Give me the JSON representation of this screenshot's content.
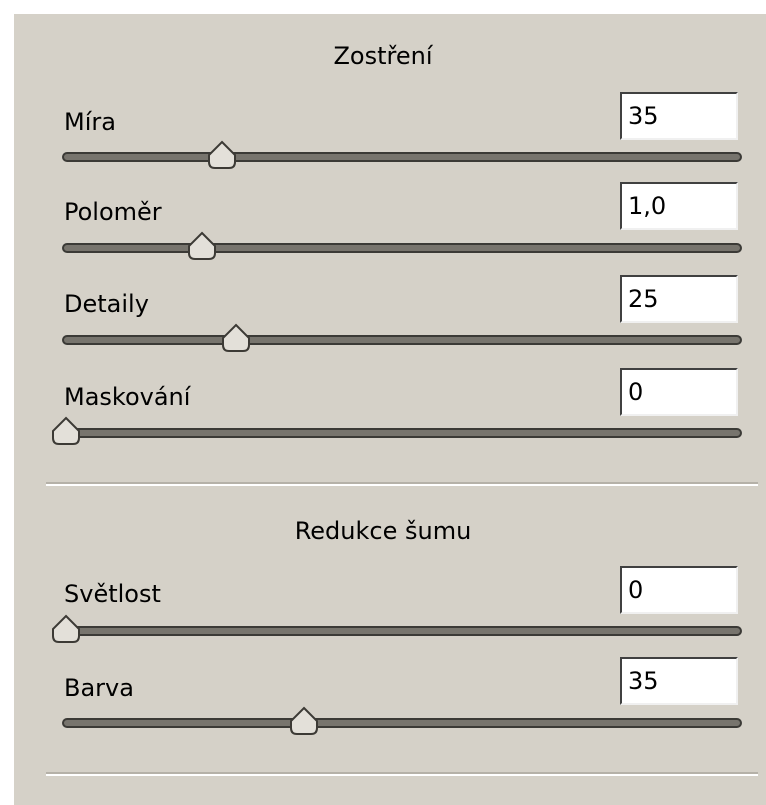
{
  "sharpening": {
    "title": "Zostření",
    "sliders": [
      {
        "label": "Míra",
        "value": "35",
        "level": 0.23
      },
      {
        "label": "Poloměr",
        "value": "1,0",
        "level": 0.2
      },
      {
        "label": "Detaily",
        "value": "25",
        "level": 0.25
      },
      {
        "label": "Maskování",
        "value": "0",
        "level": 0.0
      }
    ]
  },
  "noise_reduction": {
    "title": "Redukce šumu",
    "sliders": [
      {
        "label": "Světlost",
        "value": "0",
        "level": 0.0
      },
      {
        "label": "Barva",
        "value": "35",
        "level": 0.35
      }
    ]
  }
}
